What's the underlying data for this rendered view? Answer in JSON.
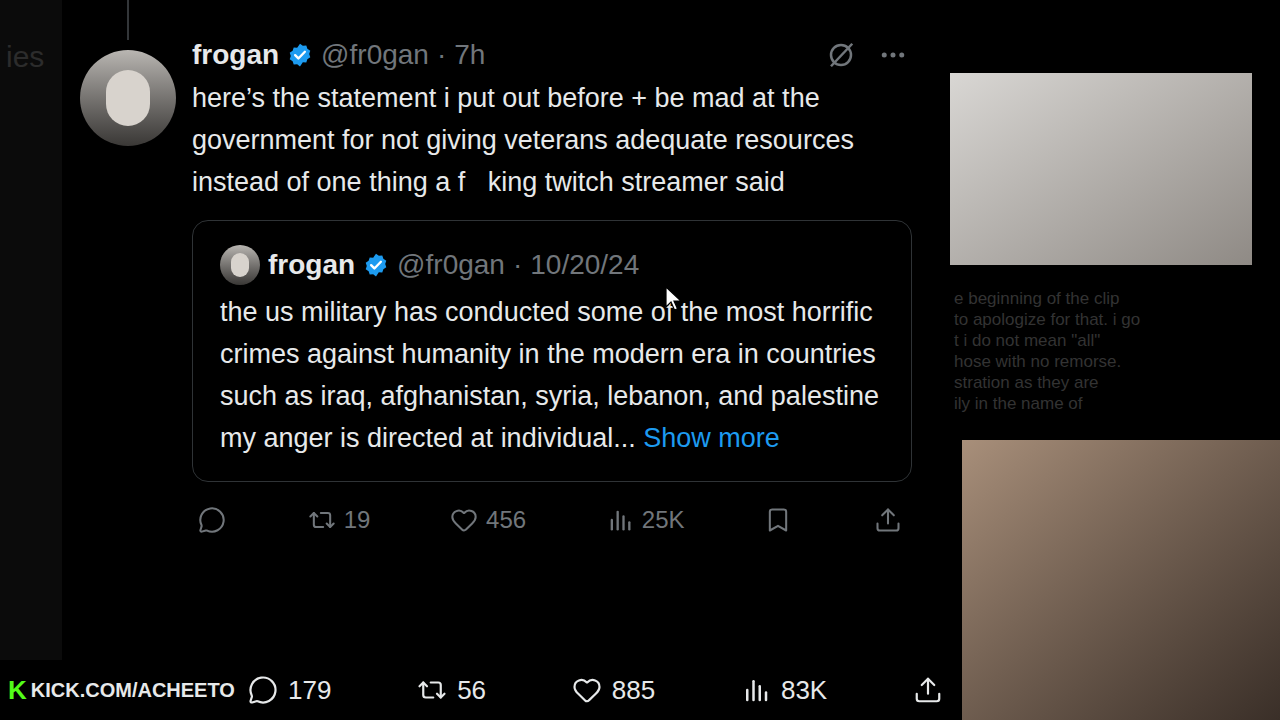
{
  "background": {
    "left_fragment": "ies",
    "side_lines": [
      "e beginning of the clip",
      "to apologize for that. i go",
      "t i do not mean \"all\"",
      "hose with no remorse.",
      "stration as they are",
      "ily in the name of"
    ]
  },
  "tweet": {
    "author": "frogan",
    "verified": true,
    "handle": "@fr0gan",
    "separator": "·",
    "time": "7h",
    "text": "here’s the statement i put out before + be mad at the government for not giving veterans adequate resources instead of one thing a f   king twitch streamer said",
    "quote": {
      "author": "frogan",
      "verified": true,
      "handle": "@fr0gan",
      "separator": "·",
      "time": "10/20/24",
      "text": "the us military has conducted some of the most horrific crimes against humanity in the modern era in countries such as iraq, afghanistan, syria, lebanon, and palestine my anger is directed at individual...",
      "more": "Show more"
    },
    "actions": [
      {
        "kind": "reply",
        "count": ""
      },
      {
        "kind": "retweet",
        "count": "19"
      },
      {
        "kind": "like",
        "count": "456"
      },
      {
        "kind": "views",
        "count": "25K"
      },
      {
        "kind": "bookmark",
        "count": ""
      },
      {
        "kind": "share",
        "count": ""
      }
    ]
  },
  "bottom_bar": {
    "watermark": {
      "logo": "K",
      "label": "KICK.COM/ACHEETO"
    },
    "actions": [
      {
        "kind": "reply",
        "count": "179"
      },
      {
        "kind": "retweet",
        "count": "56"
      },
      {
        "kind": "like",
        "count": "885"
      },
      {
        "kind": "views",
        "count": "83K"
      },
      {
        "kind": "share",
        "count": ""
      }
    ]
  },
  "webcams": [
    {
      "name": "streamer-cam"
    },
    {
      "name": "reactor-cam"
    }
  ]
}
